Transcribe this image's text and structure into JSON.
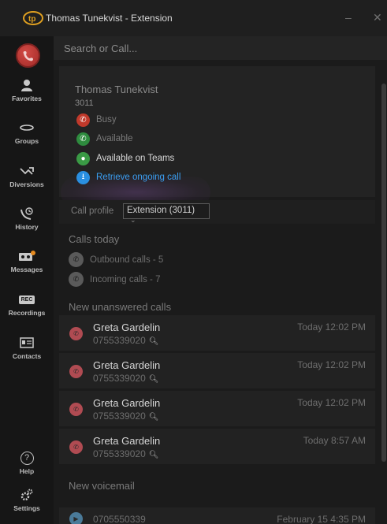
{
  "window": {
    "title": "Thomas Tunekvist - Extension",
    "minimize": "–",
    "close": "✕"
  },
  "search": {
    "placeholder": "Search or Call..."
  },
  "sidebar": {
    "items": [
      {
        "label": "Favorites",
        "icon": "person-icon"
      },
      {
        "label": "Groups",
        "icon": "groups-icon"
      },
      {
        "label": "Diversions",
        "icon": "diversion-icon"
      },
      {
        "label": "History",
        "icon": "history-icon"
      },
      {
        "label": "Messages",
        "icon": "voicemail-icon"
      },
      {
        "label": "Recordings",
        "icon": "rec-icon",
        "badge": "REC"
      },
      {
        "label": "Contacts",
        "icon": "contacts-icon"
      },
      {
        "label": "Help",
        "icon": "help-icon",
        "glyph": "?"
      },
      {
        "label": "Settings",
        "icon": "gear-icon"
      }
    ]
  },
  "user": {
    "name": "Thomas Tunekvist",
    "extension": "3011",
    "statuses": [
      {
        "label": "Busy",
        "color": "#c0392b"
      },
      {
        "label": "Available",
        "color": "#2e8b3e"
      },
      {
        "label": "Available on Teams",
        "color": "#3a9a45"
      }
    ],
    "retrieve": {
      "label": "Retrieve ongoing call",
      "color": "#2a8fe0"
    }
  },
  "profile": {
    "label": "Call profile",
    "value": "Extension (3011)"
  },
  "calls_today": {
    "title": "Calls today",
    "outbound": "Outbound calls - 5",
    "incoming": "Incoming calls - 7"
  },
  "unanswered": {
    "title": "New unanswered calls",
    "items": [
      {
        "name": "Greta Gardelin",
        "number": "0755339020",
        "time": "Today 12:02 PM"
      },
      {
        "name": "Greta Gardelin",
        "number": "0755339020",
        "time": "Today 12:02 PM"
      },
      {
        "name": "Greta Gardelin",
        "number": "0755339020",
        "time": "Today 12:02 PM"
      },
      {
        "name": "Greta Gardelin",
        "number": "0755339020",
        "time": "Today 8:57 AM"
      }
    ]
  },
  "voicemail": {
    "title": "New voicemail",
    "partial_number": "0705550339",
    "partial_time": "February 15 4:35 PM"
  }
}
